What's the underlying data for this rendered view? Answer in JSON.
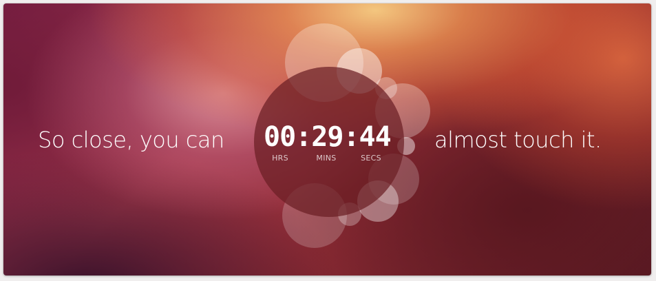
{
  "countdown": {
    "lead_text": "So close, you can",
    "trail_text": "almost touch it.",
    "hours": "00",
    "minutes": "29",
    "seconds": "44",
    "separator": ":",
    "hours_label": "HRS",
    "minutes_label": "MINS",
    "seconds_label": "SECS"
  },
  "graphic": {
    "icon": "circle-of-friends-bubbles-icon"
  },
  "colors": {
    "text": "#ffffff",
    "bubble_fill": "#ffffff",
    "disc_fill": "#6b1f24"
  }
}
